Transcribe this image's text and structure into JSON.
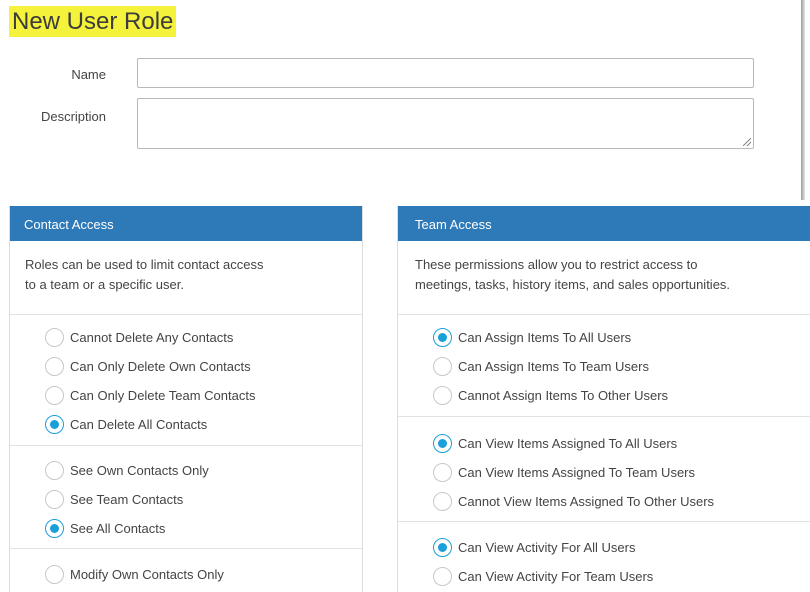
{
  "page": {
    "title": "New User Role"
  },
  "form": {
    "name_label": "Name",
    "name_value": "",
    "description_label": "Description",
    "description_value": ""
  },
  "contact_access": {
    "header": "Contact Access",
    "description_line1": "Roles can be used to limit contact access",
    "description_line2": "to a team or a specific user.",
    "groups": [
      [
        {
          "label": "Cannot Delete Any Contacts",
          "checked": false
        },
        {
          "label": "Can Only Delete Own Contacts",
          "checked": false
        },
        {
          "label": "Can Only Delete Team Contacts",
          "checked": false
        },
        {
          "label": "Can Delete All Contacts",
          "checked": true
        }
      ],
      [
        {
          "label": "See Own Contacts Only",
          "checked": false
        },
        {
          "label": "See Team Contacts",
          "checked": false
        },
        {
          "label": "See All Contacts",
          "checked": true
        }
      ],
      [
        {
          "label": "Modify Own Contacts Only",
          "checked": false
        }
      ]
    ]
  },
  "team_access": {
    "header": "Team Access",
    "description_line1": "These permissions allow you to restrict access to",
    "description_line2": "meetings, tasks, history items, and sales opportunities.",
    "groups": [
      [
        {
          "label": "Can Assign Items To All Users",
          "checked": true
        },
        {
          "label": "Can Assign Items To Team Users",
          "checked": false
        },
        {
          "label": "Cannot Assign Items To Other Users",
          "checked": false
        }
      ],
      [
        {
          "label": "Can View Items Assigned To All Users",
          "checked": true
        },
        {
          "label": "Can View Items Assigned To Team Users",
          "checked": false
        },
        {
          "label": "Cannot View Items Assigned To Other Users",
          "checked": false
        }
      ],
      [
        {
          "label": "Can View Activity For All Users",
          "checked": true
        },
        {
          "label": "Can View Activity For Team Users",
          "checked": false
        }
      ]
    ]
  },
  "colors": {
    "header_bg": "#2e7ab8",
    "radio_accent": "#1aa0d8",
    "title_highlight": "#f4f23b"
  }
}
